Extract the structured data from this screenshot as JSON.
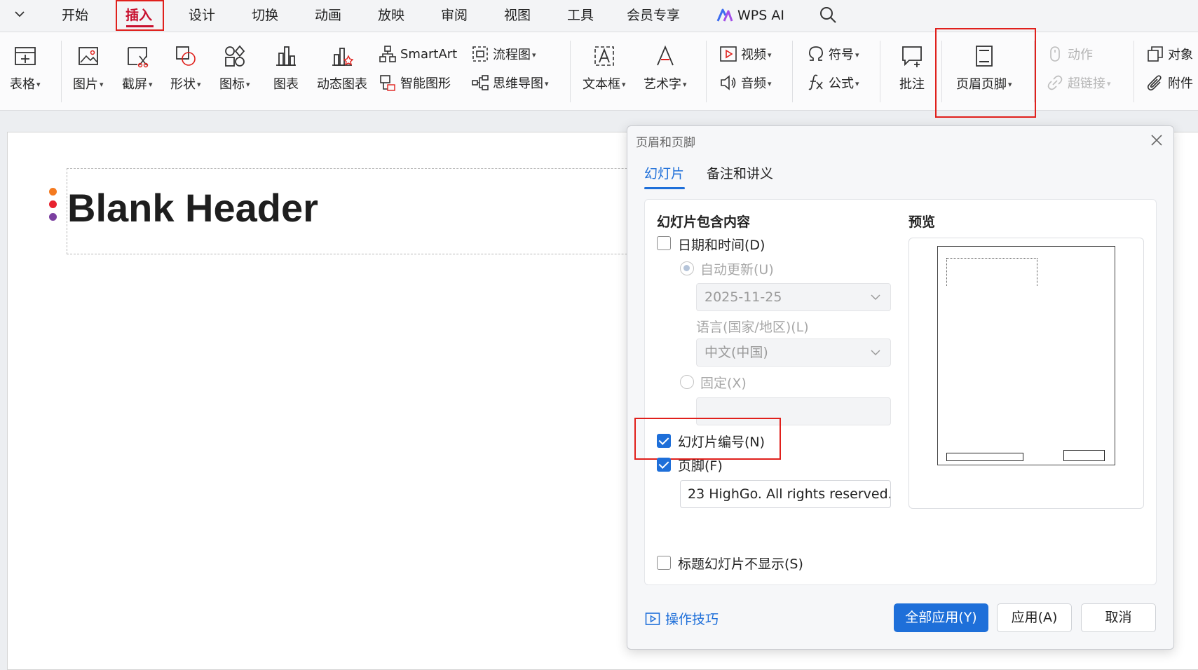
{
  "menu": {
    "tabs": [
      "开始",
      "插入",
      "设计",
      "切换",
      "动画",
      "放映",
      "审阅",
      "视图",
      "工具",
      "会员专享"
    ],
    "active_tab": "插入",
    "wps_ai": "WPS AI"
  },
  "ribbon": {
    "table": "表格",
    "picture": "图片",
    "screenshot": "截屏",
    "shape": "形状",
    "icon": "图标",
    "chart": "图表",
    "dynamic_chart": "动态图表",
    "smartart": "SmartArt",
    "smart_graphic": "智能图形",
    "flowchart": "流程图",
    "mindmap": "思维导图",
    "textbox": "文本框",
    "wordart": "艺术字",
    "video": "视频",
    "audio": "音频",
    "symbol": "符号",
    "formula": "公式",
    "comment": "批注",
    "header_footer": "页眉页脚",
    "action": "动作",
    "hyperlink": "超链接",
    "object": "对象",
    "attachment": "附件"
  },
  "slide": {
    "title": "Blank Header",
    "dot_colors": [
      "#f47a20",
      "#e8232f",
      "#7b3fa0"
    ]
  },
  "dialog": {
    "title": "页眉和页脚",
    "tabs": [
      "幻灯片",
      "备注和讲义"
    ],
    "active_tab": "幻灯片",
    "section_label": "幻灯片包含内容",
    "preview_label": "预览",
    "date_time": {
      "label": "日期和时间(D)",
      "checked": false
    },
    "auto_update": {
      "label": "自动更新(U)",
      "selected": true,
      "date_value": "2025-11-25"
    },
    "language": {
      "label": "语言(国家/地区)(L)",
      "value": "中文(中国)"
    },
    "fixed": {
      "label": "固定(X)",
      "selected": false,
      "value": ""
    },
    "slide_number": {
      "label": "幻灯片编号(N)",
      "checked": true
    },
    "footer": {
      "label": "页脚(F)",
      "checked": true,
      "value": "23 HighGo. All rights reserved."
    },
    "hide_on_title": {
      "label": "标题幻灯片不显示(S)",
      "checked": false
    },
    "tips_label": "操作技巧",
    "buttons": {
      "apply_all": "全部应用(Y)",
      "apply": "应用(A)",
      "cancel": "取消"
    }
  },
  "colors": {
    "accent": "#1e6fd9",
    "active_tab": "#c8102e",
    "highlight_box": "#e0201c"
  }
}
